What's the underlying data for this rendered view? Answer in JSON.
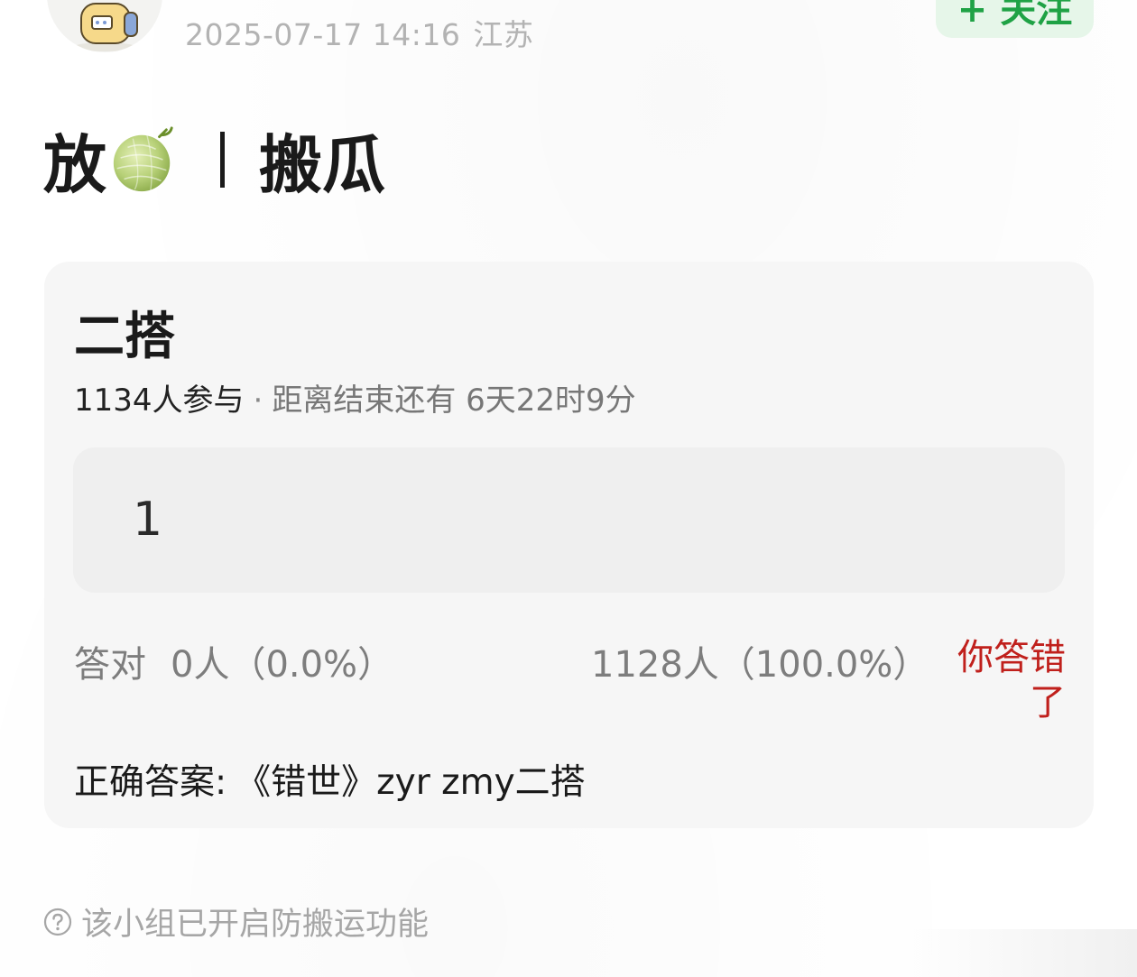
{
  "post": {
    "timestamp": "2025-07-17 14:16",
    "location": "江苏",
    "follow_label": "+ 关注"
  },
  "title": {
    "prefix": "放",
    "emoji_icon": "melon-icon",
    "suffix": "搬瓜"
  },
  "quiz": {
    "title": "二搭",
    "participants": "1134人参与",
    "separator": "·",
    "countdown": "距离结束还有 6天22时9分",
    "option_text": "1",
    "correct_label": "答对",
    "correct_result": "0人（0.0%）",
    "wrong_result": "1128人（100.0%）",
    "verdict": "你答错了",
    "answer_label": "正确答案:",
    "answer_value": "《错世》zyr zmy二搭"
  },
  "footer": {
    "notice": "该小组已开启防搬运功能",
    "notice_icon": "question-circle-icon"
  },
  "colors": {
    "brand_green": "#1fa245",
    "follow_bg": "#e6f6e9",
    "wrong_red": "#c0201c",
    "card_bg": "#f6f6f6",
    "option_bg": "#efefef"
  }
}
